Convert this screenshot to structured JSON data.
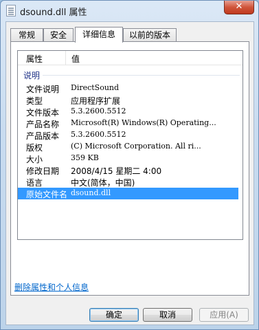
{
  "window": {
    "title": "dsound.dll 属性",
    "close_label": "✕"
  },
  "tabs": [
    {
      "label": "常规"
    },
    {
      "label": "安全"
    },
    {
      "label": "详细信息"
    },
    {
      "label": "以前的版本"
    }
  ],
  "details": {
    "col_property": "属性",
    "col_value": "值",
    "group_label": "说明",
    "rows": [
      {
        "key": "文件说明",
        "value": "DirectSound"
      },
      {
        "key": "类型",
        "value": "应用程序扩展"
      },
      {
        "key": "文件版本",
        "value": "5.3.2600.5512"
      },
      {
        "key": "产品名称",
        "value": "Microsoft(R) Windows(R) Operating..."
      },
      {
        "key": "产品版本",
        "value": "5.3.2600.5512"
      },
      {
        "key": "版权",
        "value": "(C) Microsoft Corporation. All ri..."
      },
      {
        "key": "大小",
        "value": "359 KB"
      },
      {
        "key": "修改日期",
        "value": "2008/4/15 星期二 4:00"
      },
      {
        "key": "语言",
        "value": "中文(简体，中国)"
      },
      {
        "key": "原始文件名",
        "value": "dsound.dll"
      }
    ]
  },
  "remove_link": "删除属性和个人信息",
  "buttons": {
    "ok": "确定",
    "cancel": "取消",
    "apply": "应用(A)"
  },
  "colors": {
    "selection": "#3399ff",
    "link": "#0066cc",
    "group_header": "#1e3287"
  }
}
